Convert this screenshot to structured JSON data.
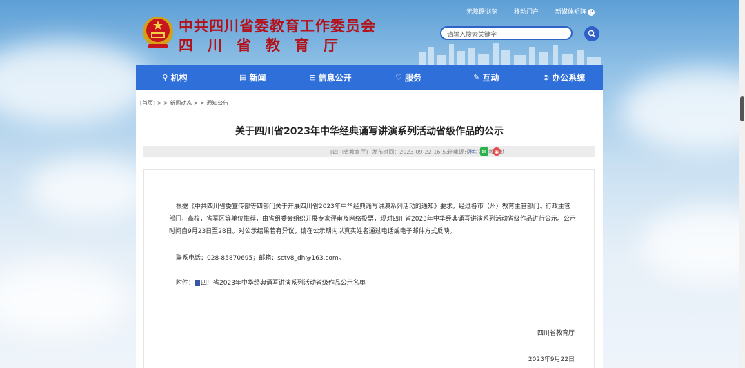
{
  "header": {
    "org_name": "中共四川省委教育工作委员会",
    "dept_name": "四川省教育厅",
    "links": [
      "无障碍浏览",
      "移动门户",
      "新媒体矩阵"
    ],
    "search_placeholder": "请输入搜索关键字",
    "accent_color": "#2f6fd9",
    "title_color": "#b3121a"
  },
  "nav": {
    "items": [
      {
        "label": "机构",
        "icon": "org-icon"
      },
      {
        "label": "新闻",
        "icon": "news-icon"
      },
      {
        "label": "信息公开",
        "icon": "info-icon"
      },
      {
        "label": "服务",
        "icon": "service-icon"
      },
      {
        "label": "互动",
        "icon": "interact-icon"
      },
      {
        "label": "办公系统",
        "icon": "office-icon"
      }
    ]
  },
  "breadcrumb": "[首页] > > 新闻动态 > > 通知公告",
  "article": {
    "title": "关于四川省2023年中华经典诵写讲演系列活动省级作品的公示",
    "source": "[四川省教育厅]",
    "publish_time": "发布时间：2023-09-22 16:53",
    "origin": "来源:语言文字教材处",
    "share_label": "分享：",
    "body": "根据《中共四川省委宣传部等四部门关于开展四川省2023年中华经典诵写讲演系列活动的通知》要求，经过各市（州）教育主管部门、行政主管部门，高校，省军区等单位推荐，由省组委会组织开展专家评审及网络投票，现对四川省2023年中华经典诵写讲演系列活动省级作品进行公示。公示时间自9月23日至28日。对公示结果若有异议，请在公示期内以真实姓名通过电话或电子邮件方式反映。",
    "contact": "联系电话：028-85870695；邮箱：sctv8_dh@163.com。",
    "attachment_prefix": "附件：",
    "attachment_name": "四川省2023年中华经典诵写讲演系列活动省级作品公示名单",
    "signature": "四川省教育厅",
    "date": "2023年9月22日"
  }
}
